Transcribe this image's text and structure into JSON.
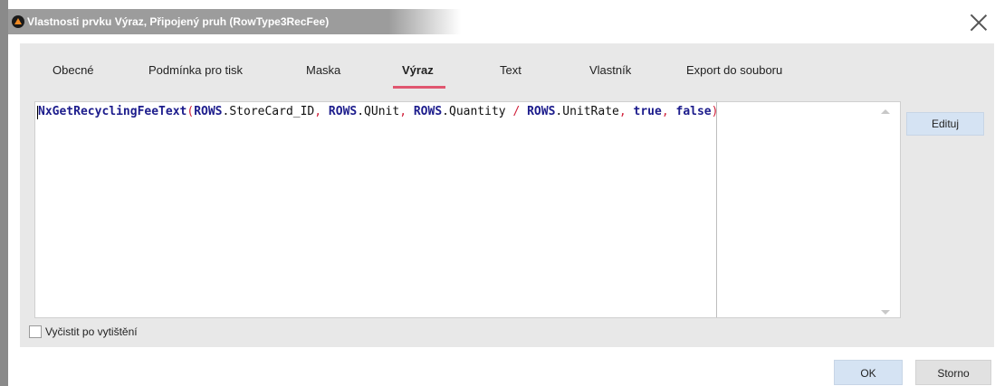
{
  "window": {
    "title": "Vlastnosti prvku Výraz, Připojený pruh (RowType3RecFee)",
    "app_icon": "app-logo-icon",
    "close_icon": "close-icon"
  },
  "tabs": [
    {
      "label": "Obecné",
      "active": false
    },
    {
      "label": "Podmínka pro tisk",
      "active": false
    },
    {
      "label": "Maska",
      "active": false
    },
    {
      "label": "Výraz",
      "active": true
    },
    {
      "label": "Text",
      "active": false
    },
    {
      "label": "Vlastník",
      "active": false
    },
    {
      "label": "Export do souboru",
      "active": false
    }
  ],
  "editor": {
    "tokens": [
      {
        "text": "NxGetRecyclingFeeText",
        "type": "kw"
      },
      {
        "text": "(",
        "type": "op"
      },
      {
        "text": "ROWS",
        "type": "kw"
      },
      {
        "text": ".StoreCard_ID",
        "type": "plain"
      },
      {
        "text": ", ",
        "type": "op"
      },
      {
        "text": "ROWS",
        "type": "kw"
      },
      {
        "text": ".QUnit",
        "type": "plain"
      },
      {
        "text": ", ",
        "type": "op"
      },
      {
        "text": "ROWS",
        "type": "kw"
      },
      {
        "text": ".Quantity ",
        "type": "plain"
      },
      {
        "text": "/ ",
        "type": "op"
      },
      {
        "text": "ROWS",
        "type": "kw"
      },
      {
        "text": ".UnitRate",
        "type": "plain"
      },
      {
        "text": ", ",
        "type": "op"
      },
      {
        "text": "true",
        "type": "kw"
      },
      {
        "text": ", ",
        "type": "op"
      },
      {
        "text": "false",
        "type": "kw"
      },
      {
        "text": ")",
        "type": "op"
      }
    ]
  },
  "side_button": {
    "label": "Edituj"
  },
  "checkbox": {
    "label": "Vyčistit po vytištění",
    "checked": false
  },
  "footer": {
    "ok_label": "OK",
    "storno_label": "Storno"
  },
  "colors": {
    "accent": "#e0566f",
    "keyword": "#1c1c8c",
    "operator": "#d0203a",
    "button": "#d5e3f3"
  }
}
